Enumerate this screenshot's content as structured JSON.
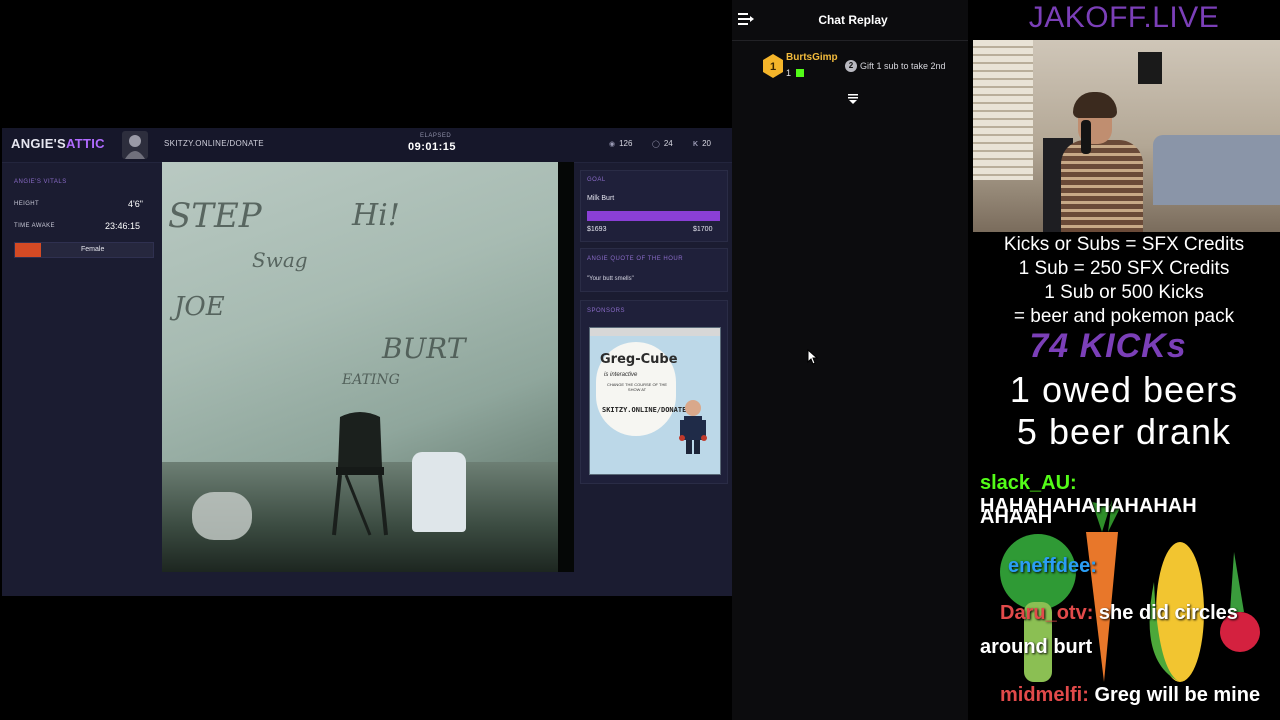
{
  "overlay": {
    "brand_main": "ANGIE'S",
    "brand_accent": "ATTIC",
    "donate_url": "SKITZY.ONLINE/DONATE",
    "elapsed_label": "ELAPSED",
    "elapsed_value": "09:01:15",
    "stats": [
      {
        "icon": "viewers-icon",
        "value": "126"
      },
      {
        "icon": "subs-icon",
        "value": "24"
      },
      {
        "icon": "kick-icon",
        "value": "20"
      }
    ],
    "vitals": {
      "title": "ANGIE'S VITALS",
      "height_label": "HEIGHT",
      "height_value": "4'6\"",
      "awake_label": "TIME AWAKE",
      "awake_value": "23:46:15",
      "gender": "Female"
    },
    "goal": {
      "title": "GOAL",
      "name": "Milk Burt",
      "progress": 1.0,
      "current": "$1693",
      "target": "$1700"
    },
    "quote": {
      "title": "ANGIE QUOTE OF THE HOUR",
      "text": "\"Your butt smells\""
    },
    "sponsors": {
      "title": "SPONSORS",
      "ad_title": "Greg-Cube",
      "ad_sub": "is interactive",
      "ad_small": "CHANGE THE COURSE OF THE SHOW AT",
      "ad_url": "SKITZY.ONLINE/DONATE"
    }
  },
  "chat_replay": {
    "title": "Chat Replay",
    "top_gifter": {
      "rank": "1",
      "name": "BurtsGimp",
      "count": "1"
    },
    "second_rank": "2",
    "second_text": "Gift 1 sub to take 2nd"
  },
  "right_overlay": {
    "title": "JAKOFF.LIVE",
    "info_lines": [
      "Kicks or Subs = SFX Credits",
      "1 Sub = 250 SFX Credits",
      "1 Sub or 500 Kicks",
      "= beer and pokemon pack"
    ],
    "kicks": "74 KICKs",
    "owed_beers": "1 owed beers",
    "beers_drank": "5 beer drank",
    "chat": [
      {
        "user": "slack_AU:",
        "text": "HAHAHAHAHAHAHAH"
      },
      {
        "user": "",
        "text": "AHAAH"
      },
      {
        "user": "eneffdee:",
        "text": ""
      },
      {
        "user": "Daru_otv:",
        "text": "she did circles"
      },
      {
        "user": "",
        "text": "around burt"
      },
      {
        "user": "midmelfi:",
        "text": "Greg will be mine"
      }
    ]
  }
}
